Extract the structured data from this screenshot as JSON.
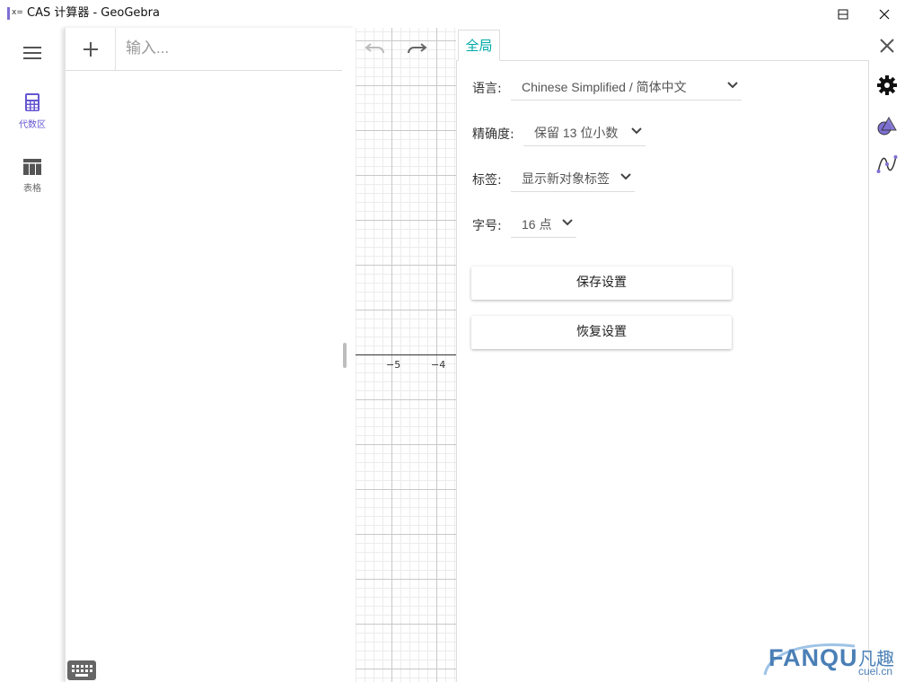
{
  "window": {
    "title": "CAS 计算器 - GeoGebra",
    "app_icon_glyph": "x="
  },
  "leftnav": {
    "items": [
      {
        "label": "代数区",
        "icon": "calculator-icon",
        "active": true
      },
      {
        "label": "表格",
        "icon": "table-icon",
        "active": false
      }
    ]
  },
  "algebra": {
    "input_placeholder": "输入...",
    "input_value": ""
  },
  "graphics": {
    "tick_labels": [
      "−5",
      "−4"
    ]
  },
  "settings": {
    "tab_label": "全局",
    "rows": [
      {
        "label": "语言:",
        "value": "Chinese Simplified / 简体中文"
      },
      {
        "label": "精确度:",
        "value": "保留 13 位小数"
      },
      {
        "label": "标签:",
        "value": "显示新对象标签"
      },
      {
        "label": "字号:",
        "value": "16 点"
      }
    ],
    "save_label": "保存设置",
    "restore_label": "恢复设置"
  },
  "righttool": {
    "icons": [
      "close-icon",
      "gear-icon",
      "shapes-icon",
      "graph-icon"
    ]
  },
  "watermark": {
    "main": "FANQU",
    "cn": "凡趣",
    "url": "cuel.cn"
  },
  "colors": {
    "accent": "#6557d2",
    "tab_teal": "#00a8a8",
    "watermark_blue": "#4a7fb6"
  }
}
